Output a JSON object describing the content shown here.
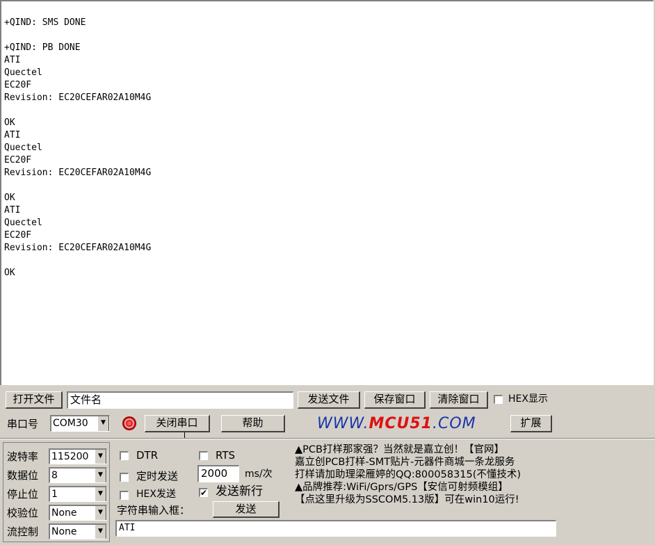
{
  "terminal": {
    "lines": [
      "+QIND: SMS DONE",
      "",
      "+QIND: PB DONE",
      "ATI",
      "Quectel",
      "EC20F",
      "Revision: EC20CEFAR02A10M4G",
      "",
      "OK",
      "ATI",
      "Quectel",
      "EC20F",
      "Revision: EC20CEFAR02A10M4G",
      "",
      "OK",
      "ATI",
      "Quectel",
      "EC20F",
      "Revision: EC20CEFAR02A10M4G",
      "",
      "OK"
    ]
  },
  "file_row": {
    "open_file_label": "打开文件",
    "filename_value": "文件名",
    "send_file_label": "发送文件",
    "save_window_label": "保存窗口",
    "clear_window_label": "清除窗口",
    "hex_display_label": "HEX显示"
  },
  "port_row": {
    "port_label": "串口号",
    "port_value": "COM30",
    "close_port_label": "关闭串口",
    "help_label": "帮助",
    "link_prefix": "WWW.",
    "link_brand": "MCU51",
    "link_suffix": ".COM",
    "expand_label": "扩展",
    "status_color": "#d11"
  },
  "settings": {
    "baud_label": "波特率",
    "baud_value": "115200",
    "databits_label": "数据位",
    "databits_value": "8",
    "stopbits_label": "停止位",
    "stopbits_value": "1",
    "parity_label": "校验位",
    "parity_value": "None",
    "flow_label": "流控制",
    "flow_value": "None"
  },
  "options": {
    "dtr_label": "DTR",
    "rts_label": "RTS",
    "timed_send_label": "定时发送",
    "interval_value": "2000",
    "interval_unit": "ms/次",
    "hex_send_label": "HEX发送",
    "send_newline_label": "发送新行",
    "input_box_label": "字符串输入框：",
    "send_label": "发送"
  },
  "ads": {
    "line1": "▲PCB打样那家强？当然就是嘉立创！【官网】",
    "line2": "嘉立创PCB打样-SMT贴片-元器件商城一条龙服务",
    "line3": "打样请加助理梁雁婷的QQ:800058315(不懂技术)",
    "line4": "▲品牌推荐:WiFi/Gprs/GPS【安信可射频模组】",
    "line5": "【点这里升级为SSCOM5.13版】可在win10运行!"
  },
  "send_input": {
    "value": "ATI"
  }
}
